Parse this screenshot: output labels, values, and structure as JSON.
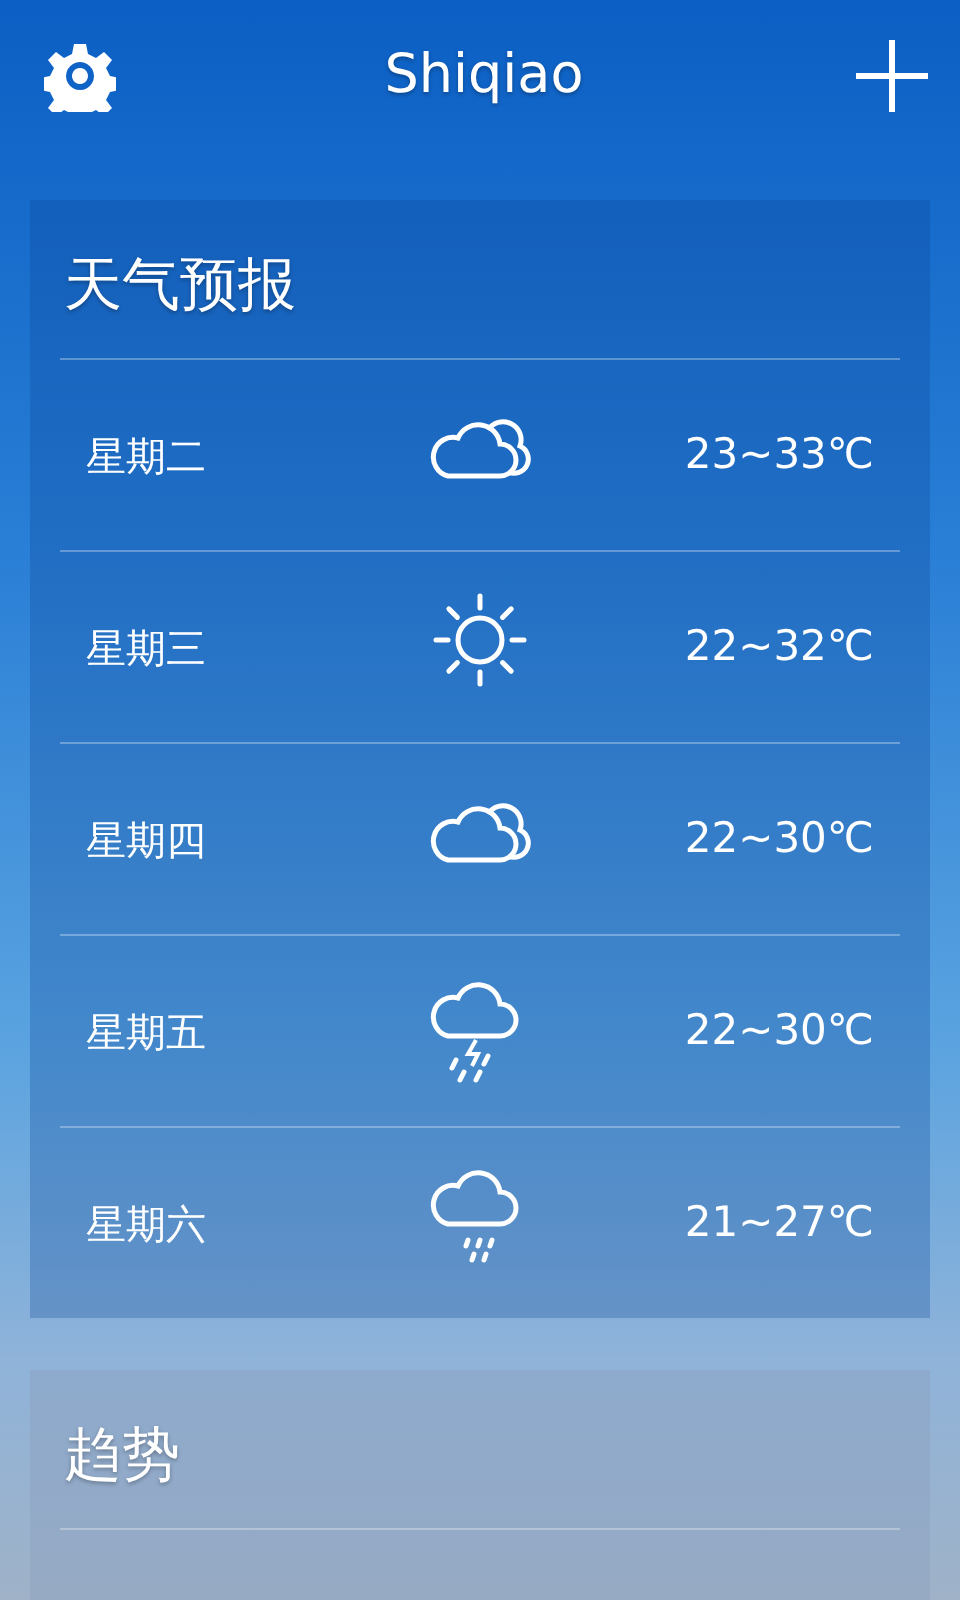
{
  "header": {
    "title": "Shiqiao"
  },
  "forecast": {
    "title": "天气预报",
    "days": [
      {
        "day": "星期二",
        "kind": "cloudy",
        "temp": "23~33℃"
      },
      {
        "day": "星期三",
        "kind": "sunny",
        "temp": "22~32℃"
      },
      {
        "day": "星期四",
        "kind": "cloudy",
        "temp": "22~30℃"
      },
      {
        "day": "星期五",
        "kind": "thunder",
        "temp": "22~30℃"
      },
      {
        "day": "星期六",
        "kind": "rain",
        "temp": "21~27℃"
      }
    ]
  },
  "trend": {
    "title": "趋势"
  }
}
